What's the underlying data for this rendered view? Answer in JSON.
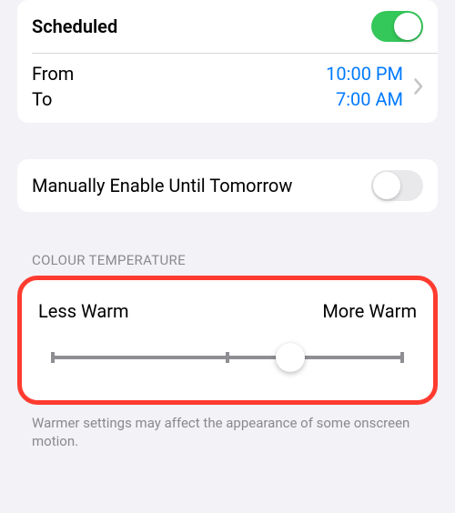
{
  "schedule": {
    "scheduled_label": "Scheduled",
    "scheduled_on": true,
    "from_label": "From",
    "to_label": "To",
    "from_time": "10:00 PM",
    "to_time": "7:00 AM"
  },
  "manual": {
    "label": "Manually Enable Until Tomorrow",
    "on": false
  },
  "temperature": {
    "header": "COLOUR TEMPERATURE",
    "less_label": "Less Warm",
    "more_label": "More Warm",
    "slider_percent": 68,
    "footer": "Warmer settings may affect the appearance of some onscreen motion."
  },
  "colors": {
    "highlight": "#ff3b30",
    "link": "#007aff",
    "toggle_on": "#34c759"
  }
}
